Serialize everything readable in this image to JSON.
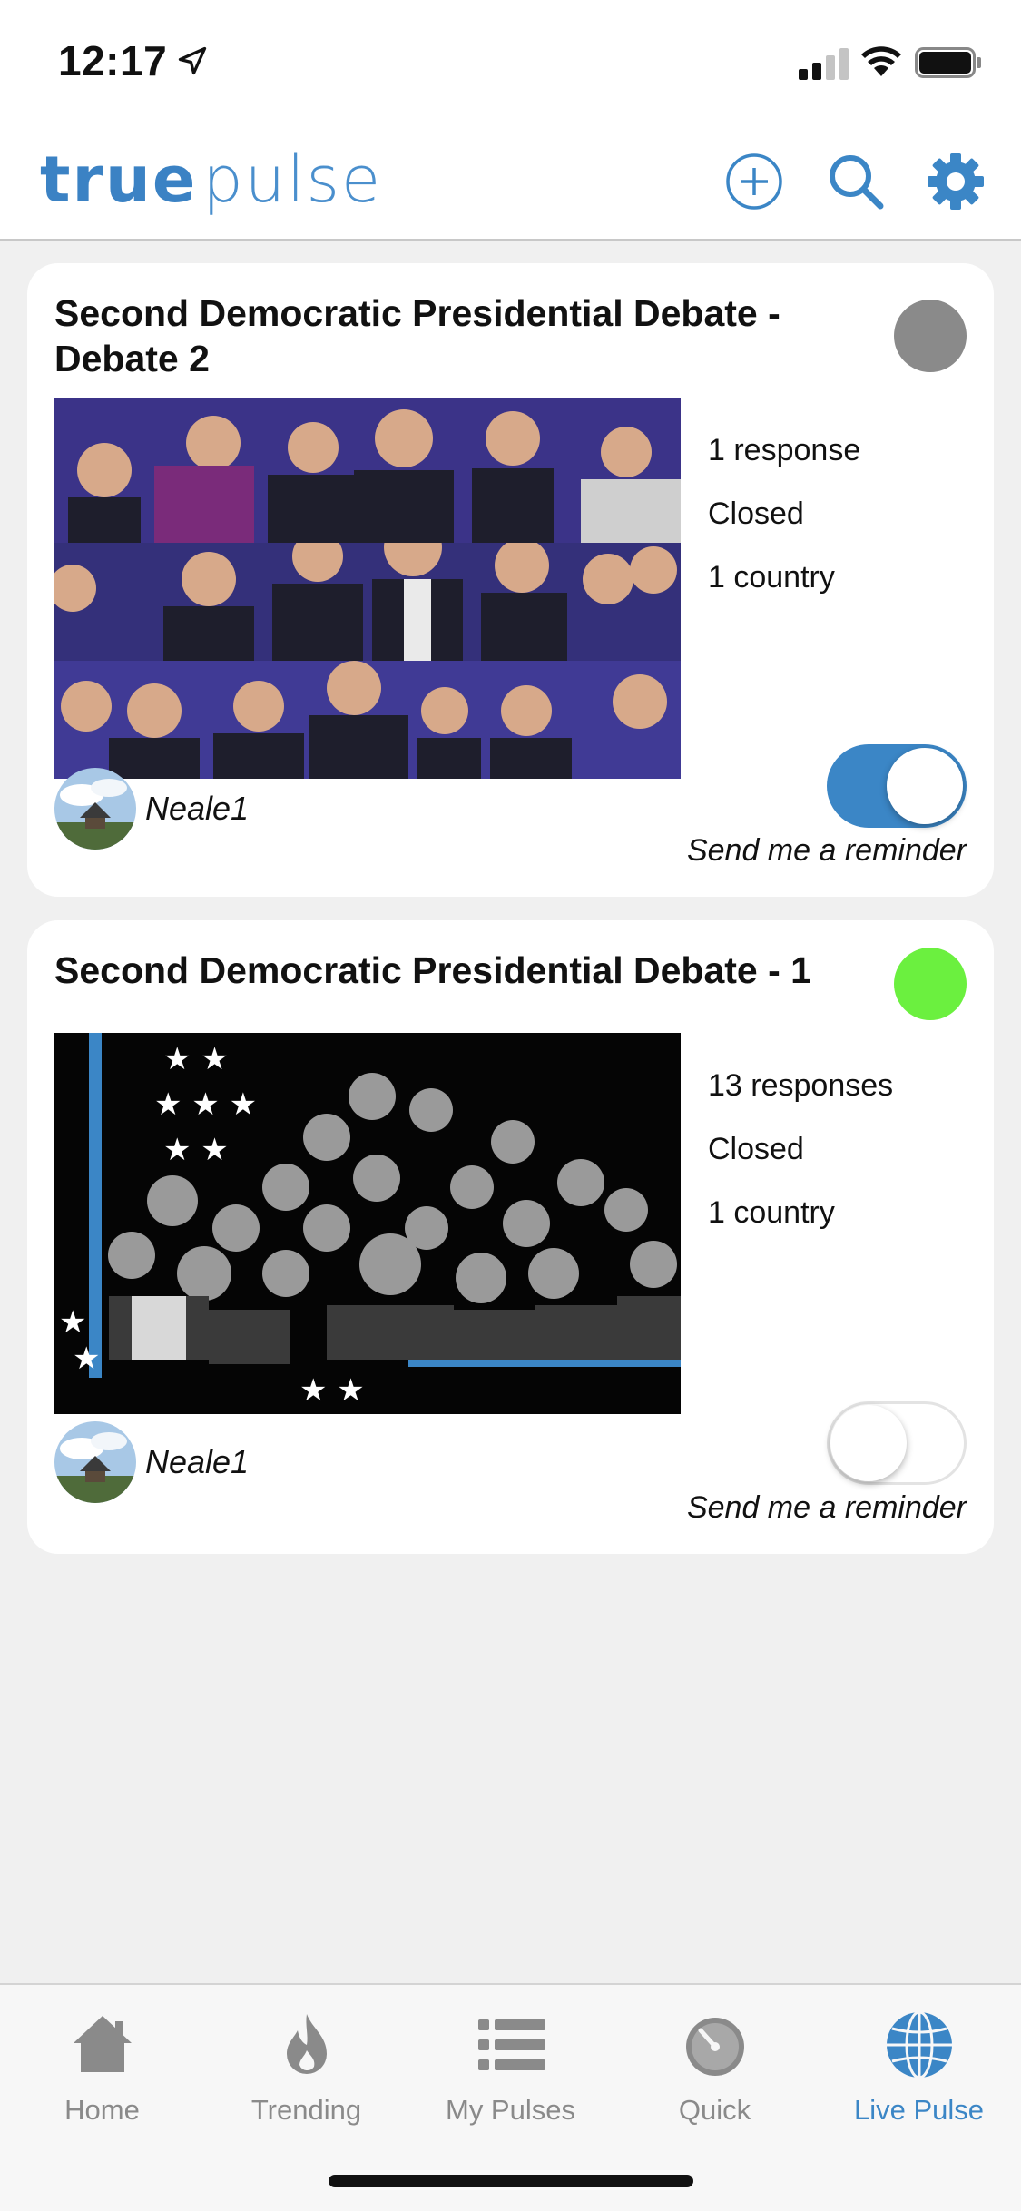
{
  "status_bar": {
    "time": "12:17"
  },
  "header": {
    "logo_part1": "true",
    "logo_part2": "pulse"
  },
  "pulses": [
    {
      "title": "Second Democratic Presidential Debate - Debate 2",
      "status_color": "#8a8a8a",
      "stats": [
        "1 response",
        "Closed",
        "1 country"
      ],
      "author": "Neale1",
      "reminder_label": "Send me a reminder",
      "reminder_on": true
    },
    {
      "title": "Second Democratic Presidential Debate - 1",
      "status_color": "#6bf03f",
      "stats": [
        "13 responses",
        "Closed",
        "1 country"
      ],
      "author": "Neale1",
      "reminder_label": "Send me a reminder",
      "reminder_on": false
    }
  ],
  "tabs": [
    {
      "label": "Home",
      "icon": "home-icon"
    },
    {
      "label": "Trending",
      "icon": "flame-icon"
    },
    {
      "label": "My Pulses",
      "icon": "list-icon"
    },
    {
      "label": "Quick",
      "icon": "timer-icon"
    },
    {
      "label": "Live Pulse",
      "icon": "globe-icon",
      "active": true
    }
  ],
  "colors": {
    "accent": "#3b86c6",
    "inactive": "#8a8a8a"
  }
}
